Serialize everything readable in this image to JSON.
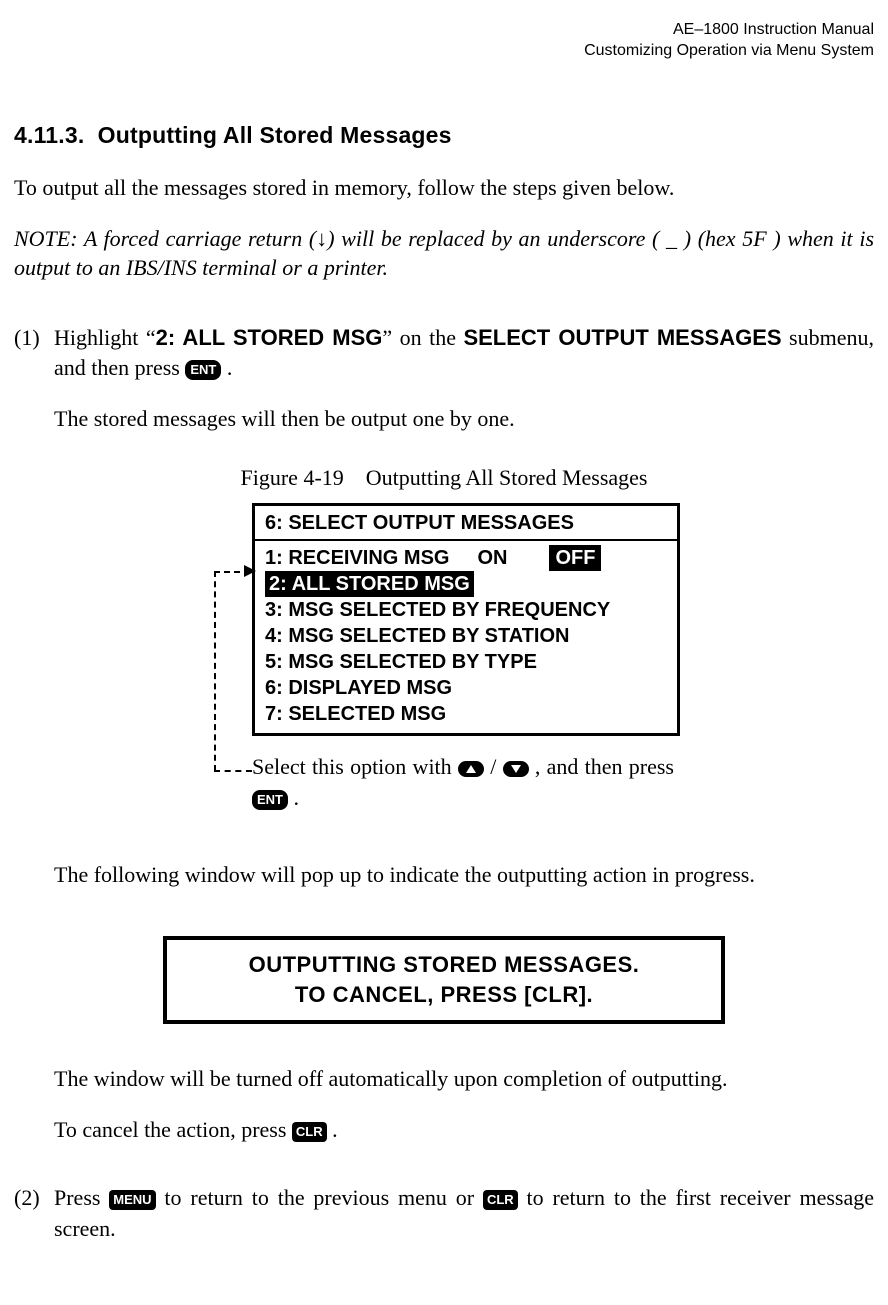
{
  "header": {
    "line1": "AE–1800 Instruction Manual",
    "line2": "Customizing Operation via Menu System"
  },
  "section": {
    "number": "4.11.3.",
    "title": "Outputting All Stored Messages"
  },
  "intro": "To output all the messages stored in memory, follow the steps given below.",
  "note": "NOTE: A forced carriage return (↓) will be replaced by an underscore ( _ ) (hex 5F ) when it is output to an IBS/INS terminal or a printer.",
  "step1": {
    "num": "(1)",
    "a": "Highlight “",
    "menu_bold": "2: ALL STORED MSG",
    "b": "” on the ",
    "menu_sel": "SELECT OUTPUT MESSAGES",
    "c": " submenu, and then press ",
    "key": "ENT",
    "d": " .",
    "after": "The stored messages will then be output one by one."
  },
  "figure": {
    "caption": "Figure 4-19 Outputting All Stored Messages",
    "panel_title": "6: SELECT OUTPUT MESSAGES",
    "row1_label": "1: RECEIVING MSG",
    "row1_on": "ON",
    "row1_off": "OFF",
    "row2": "2: ALL STORED MSG",
    "row3": "3: MSG SELECTED BY FREQUENCY",
    "row4": "4: MSG SELECTED BY STATION",
    "row5": "5: MSG SELECTED BY TYPE",
    "row6": "6: DISPLAYED MSG",
    "row7": "7: SELECTED MSG",
    "caption2a": "Select this option with ",
    "caption2b": " / ",
    "caption2c": " , and then press ",
    "caption2_key": "ENT",
    "caption2d": " ."
  },
  "para2": "The following window will pop up to indicate the outputting action in progress.",
  "popup": {
    "line1": "OUTPUTTING STORED MESSAGES.",
    "line2": "TO CANCEL, PRESS [CLR]."
  },
  "para3": "The window will be turned off automatically upon completion of outputting.",
  "para4a": "To cancel the action, press ",
  "para4_key": "CLR",
  "para4b": " .",
  "step2": {
    "num": "(2)",
    "a": "Press ",
    "key1": "MENU",
    "b": " to return to the previous menu or ",
    "key2": "CLR",
    "c": " to return to the first receiver message screen."
  }
}
